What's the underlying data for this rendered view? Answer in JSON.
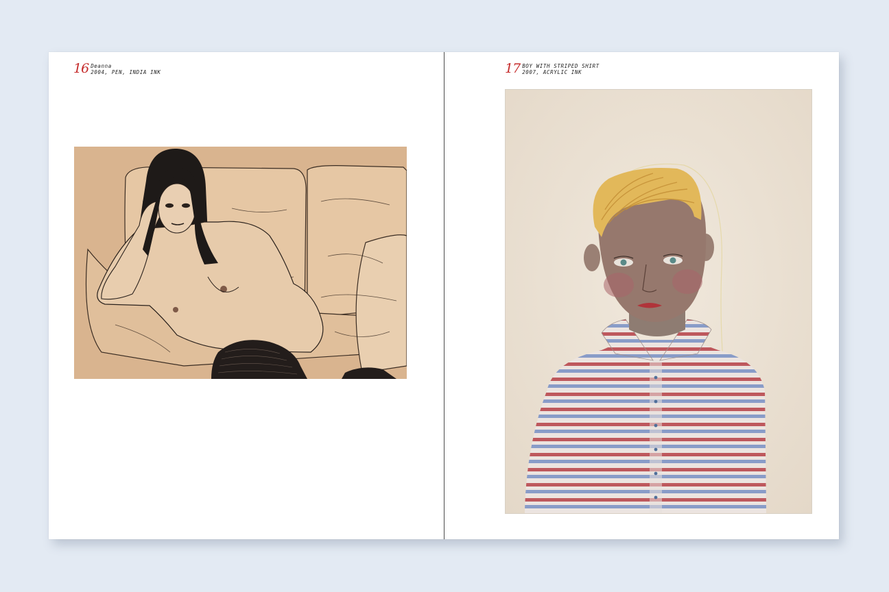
{
  "left_page": {
    "number": "16",
    "title": "Deanna",
    "details": "2004, PEN, INDIA INK"
  },
  "right_page": {
    "number": "17",
    "title": "BOY WITH STRIPED SHIRT",
    "details": "2007, ACRYLIC INK"
  },
  "colors": {
    "background": "#e3eaf3",
    "page": "#ffffff",
    "page_number": "#c52a2a",
    "kraft_paper": "#d9b48f",
    "watercolor_paper": "#ece2d5",
    "hair_blonde": "#e2b85a",
    "stripe_red": "#b9494f",
    "stripe_blue": "#7f95c6"
  }
}
